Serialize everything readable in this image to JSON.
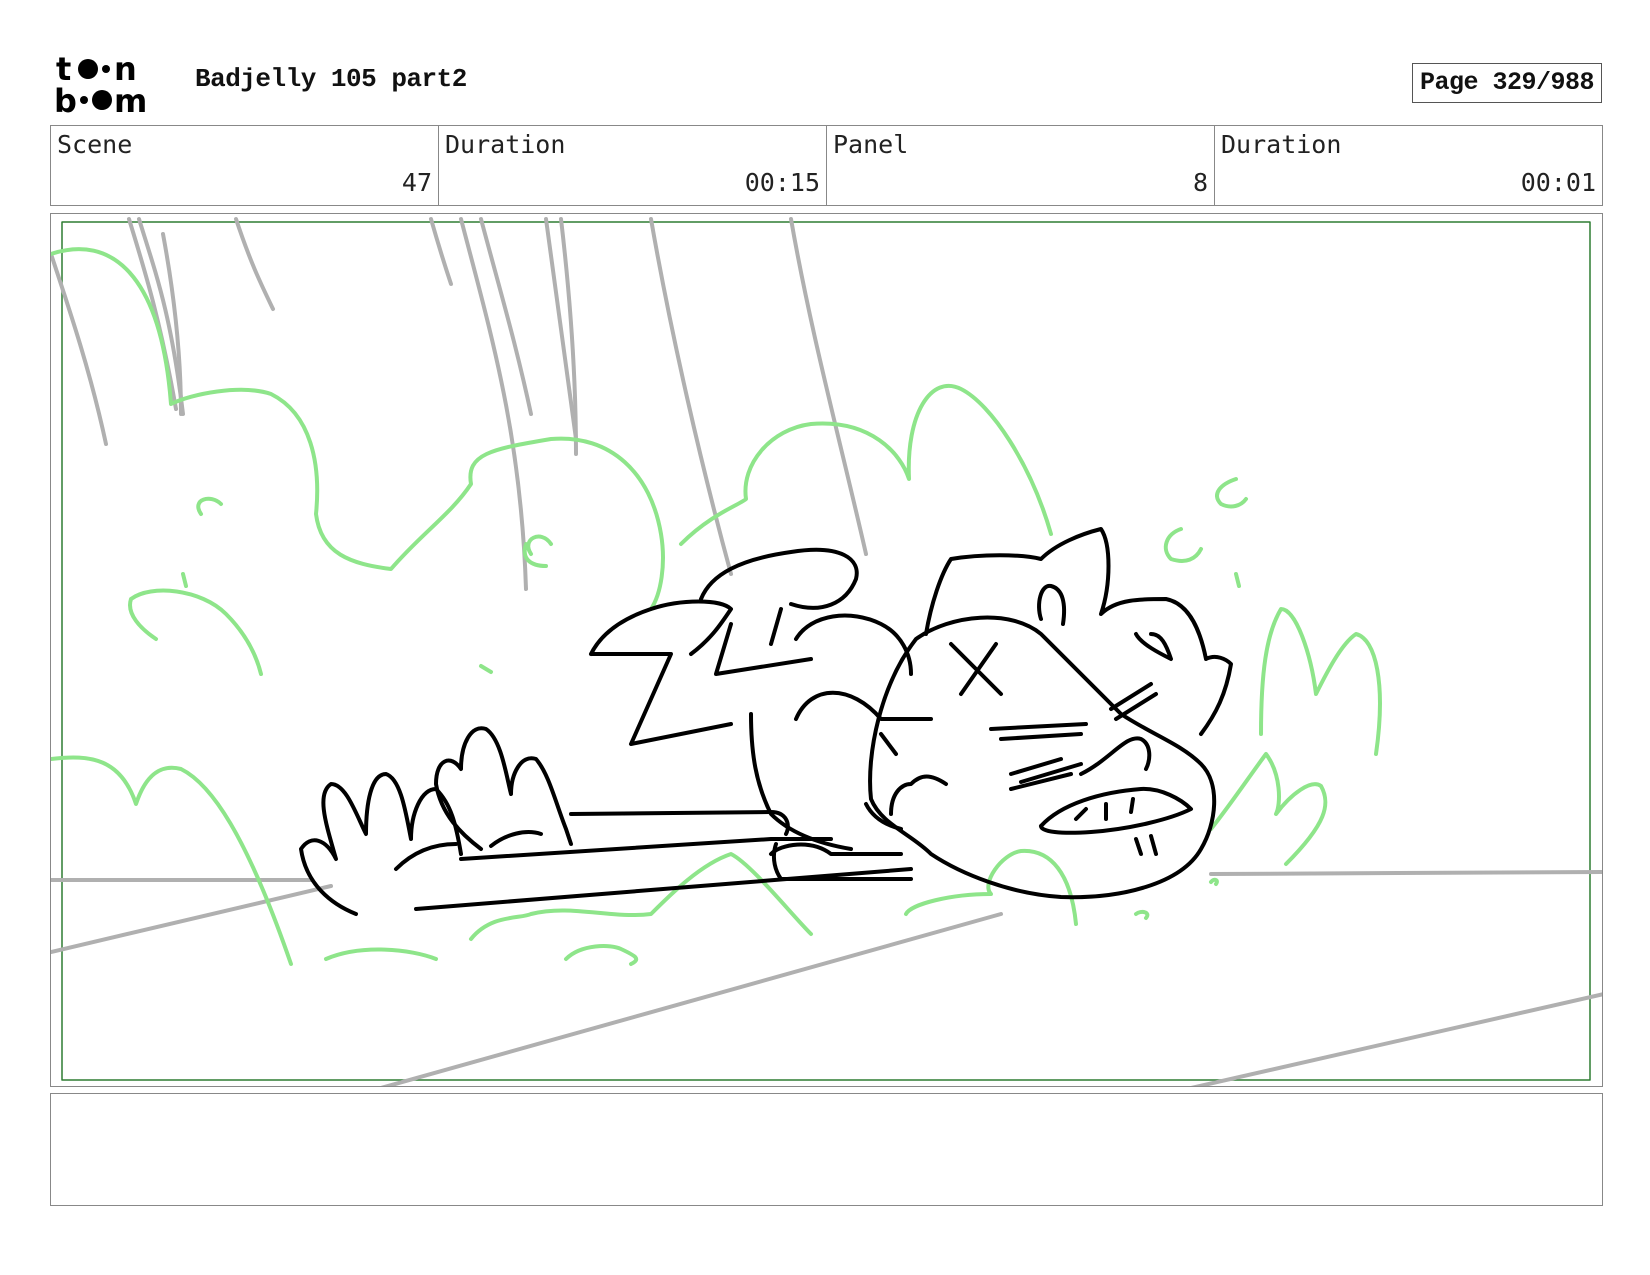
{
  "header": {
    "logo_top": "to",
    "logo_bottom": "b",
    "title": "Badjelly 105 part2",
    "page_label": "Page 329/988"
  },
  "info": {
    "scene_label": "Scene",
    "scene_value": "47",
    "scene_duration_label": "Duration",
    "scene_duration_value": "00:15",
    "panel_label": "Panel",
    "panel_value": "8",
    "panel_duration_label": "Duration",
    "panel_duration_value": "00:01"
  },
  "colors": {
    "frame_green": "#2e7d32",
    "bush_green": "#8ee58a",
    "ink": "#000000",
    "guide_gray": "#b0b0b0"
  },
  "notes": {
    "text": ""
  }
}
